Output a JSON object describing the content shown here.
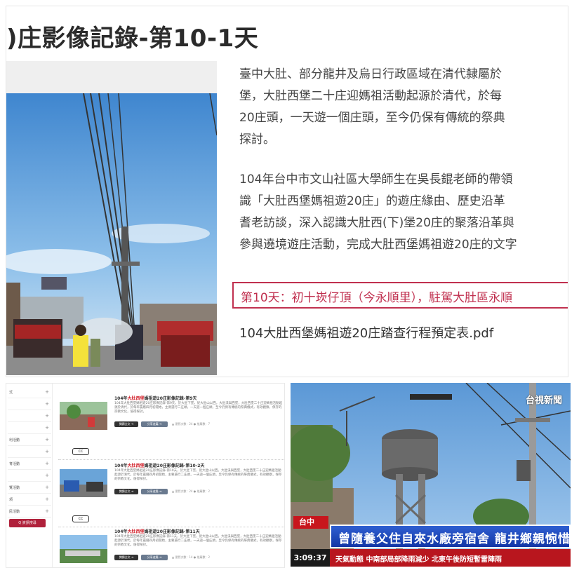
{
  "top": {
    "title": ")庄影像記錄-第10-1天",
    "paragraph1": [
      "臺中大肚、部分龍井及烏日行政區域在清代隸屬於",
      "堡，大肚西堡二十庄迎媽祖活動起源於清代，於每",
      "20庄頭，一天遊一個庄頭，至今仍保有傳統的祭典",
      "探討。"
    ],
    "paragraph2": [
      "104年台中市文山社區大學師生在吳長錕老師的帶領",
      "識「大肚西堡媽祖遊20庄」的遊庄緣由、歷史沿革",
      "耆老訪談，深入認識大肚西(下)堡20庄的聚落沿革與",
      "參與遶境遊庄活動，完成大肚西堡媽祖遊20庄的文字"
    ],
    "highlight": "第10天：初十崁仔頂（今永順里），駐駕大肚區永順",
    "pdf_link": "104大肚西堡媽祖遊20庄踏查行程預定表.pdf"
  },
  "bottom_left": {
    "sidebar_items": [
      {
        "label": "式",
        "icon": "plus-icon"
      },
      {
        "label": "",
        "icon": "plus-icon"
      },
      {
        "label": "",
        "icon": "plus-icon"
      },
      {
        "label": "",
        "icon": "plus-icon"
      },
      {
        "label": "利活動",
        "icon": "plus-icon"
      },
      {
        "label": "",
        "icon": "plus-icon"
      },
      {
        "label": "育活動",
        "icon": "plus-icon"
      },
      {
        "label": "",
        "icon": "plus-icon"
      },
      {
        "label": "覽活動",
        "icon": "plus-icon"
      },
      {
        "label": "",
        "icon": "plus-icon"
      },
      {
        "label": "",
        "icon": "plus-icon"
      },
      {
        "label": "項",
        "icon": "plus-icon"
      },
      {
        "label": "民活動",
        "icon": "plus-icon"
      }
    ],
    "sidebar_button": "Q 資訊搜尋",
    "entries": [
      {
        "title_prefix": "104年",
        "title_red": "大肚西堡",
        "title_suffix": "媽祖遊20庄影像記錄-第9天",
        "body": "104年大肚西堡媽祖遊20庄影像記錄-第9天，於大肚下堡，從大肚山以西，大肚溪與西堡，大肚西堡二十庄迎媽祖活動起源於清代，於每年農曆四月初開始，主要遶行二庄頭，一天遊一個庄頭，至今仍保有傳統的祭典儀式，有效觀察，保存的宗教文化，值得探討。",
        "btn_more": "閱讀全文 ➜",
        "btn_share": "分享這篇 ➜",
        "meta": "▲ 瀏覽次數：24  ● 推薦數：7"
      },
      {
        "title_prefix": "104年",
        "title_red": "大肚西堡",
        "title_suffix": "媽祖遊20庄影像記錄-第10-2天",
        "body": "104年大肚西堡媽祖遊20庄影像記錄-第10天，於大肚下堡，從大肚山以西，大肚溪與西堡，大肚西堡二十庄迎媽祖活動起源於清代，於每年農曆四月初開始，主要遶行二庄頭，一天遊一個庄頭，至今仍保有傳統的祭典儀式，有效觀察，保存的宗教文化，值得探討。",
        "btn_more": "閱讀全文 ➜",
        "btn_share": "分享這篇 ➜",
        "meta": "▲ 瀏覽次數：24  ● 推薦數：2"
      },
      {
        "title_prefix": "104年",
        "title_red": "大肚西堡",
        "title_suffix": "媽祖遊20庄影像記錄-第11天",
        "body": "104年大肚西堡媽祖遊20庄影像記錄-第11天，於大肚下堡，從大肚山以西，大肚溪與西堡，大肚西堡二十庄迎媽祖活動起源於清代，於每年農曆四月初開始，主要遶行二庄頭，一天遊一個庄頭，至今仍保有傳統的祭典儀式，有效觀察，保存的宗教文化，值得探討。",
        "btn_more": "閱讀全文 ➜",
        "btn_share": "分享這篇 ➜",
        "meta": "▲ 瀏覽次數：14  ● 推薦數：2"
      }
    ],
    "cc_label": "cc"
  },
  "bottom_right": {
    "logo": "台視新聞",
    "location": "台中",
    "headline": "曾隨養父住自來水廠旁宿舍 龍井鄉親惋惜",
    "time": "3:09:37",
    "ticker": "天氣動態  中南部局部降雨減少  北東午後防短暫雷陣雨"
  }
}
